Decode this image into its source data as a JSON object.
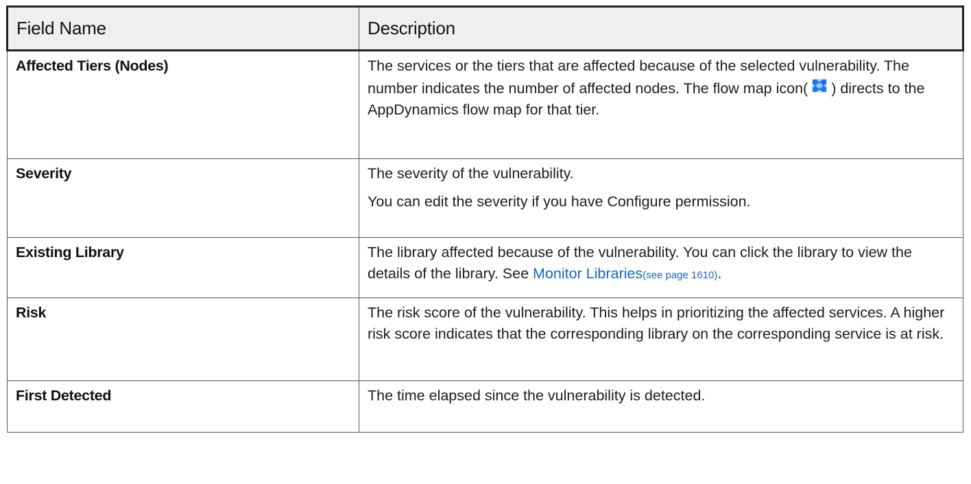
{
  "headers": {
    "field": "Field Name",
    "description": "Description"
  },
  "rows": [
    {
      "field": "Affected Tiers (Nodes)",
      "p1": "The services or the tiers that are affected because of the selected vulnerability. The number indicates the number of affected nodes. The flow map icon(",
      "p1_after": ") directs to the AppDynamics flow map for that tier.",
      "icon": "flow-map-icon"
    },
    {
      "field": "Severity",
      "p1": "The severity of the vulnerability.",
      "p2": "You can edit the severity if you have Configure permission."
    },
    {
      "field": "Existing Library",
      "p1": "The library affected because of the vulnerability. You can click the library to view the details of the library. See ",
      "link": "Monitor Libraries",
      "link_small": "(see page 1610)",
      "p1_end": "."
    },
    {
      "field": "Risk",
      "p1": "The risk score of the vulnerability. This helps in prioritizing the affected services. A higher risk score indicates that the corresponding library on the corresponding service is at risk."
    },
    {
      "field": "First Detected",
      "p1": "The time elapsed since the vulnerability is detected."
    }
  ],
  "colors": {
    "link": "#1565c0",
    "icon": "#1a73e8",
    "header_bg": "#efefef"
  }
}
